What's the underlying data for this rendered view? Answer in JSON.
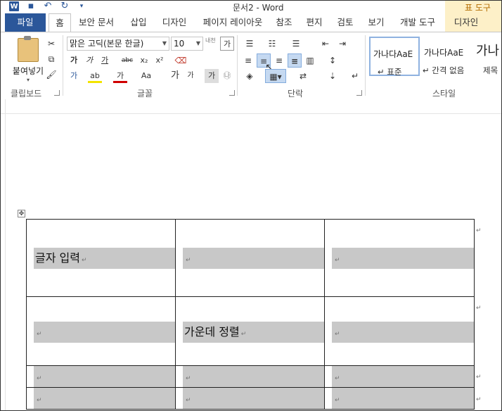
{
  "window": {
    "title": "문서2 - Word",
    "context_tab_group": "표 도구"
  },
  "tabs": [
    "파일",
    "홈",
    "보안 문서",
    "삽입",
    "디자인",
    "페이지 레이아웃",
    "참조",
    "편지",
    "검토",
    "보기",
    "개발 도구",
    "디자인"
  ],
  "clipboard": {
    "paste_label": "붙여넣기",
    "group_label": "클립보드"
  },
  "font": {
    "name": "맑은 고딕(본문 한글)",
    "size": "10",
    "group_label": "글꼴",
    "side_label": "내천"
  },
  "paragraph": {
    "group_label": "단락"
  },
  "styles": {
    "group_label": "스타일",
    "items": [
      {
        "preview": "가나다AaE",
        "name": "표준"
      },
      {
        "preview": "가나다AaE",
        "name": "간격 없음"
      },
      {
        "preview": "가나",
        "name": "제목"
      }
    ]
  },
  "table": {
    "rows": [
      [
        "글자 입력",
        "",
        ""
      ],
      [
        "",
        "가운데 정렬",
        ""
      ],
      [
        "",
        "",
        ""
      ],
      [
        "",
        "",
        ""
      ]
    ]
  },
  "glyphs": {
    "para_mark": "↵",
    "move": "✥"
  }
}
